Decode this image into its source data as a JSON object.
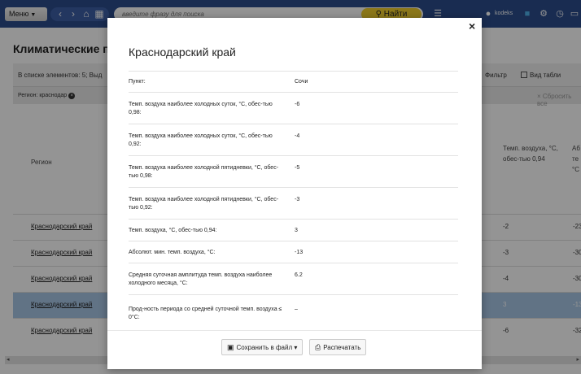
{
  "toolbar": {
    "menu_label": "Меню",
    "search_placeholder": "введите фразу для поиска",
    "search_button": "Найти",
    "user_label": "kodeks"
  },
  "page": {
    "title": "Климатические па",
    "list_info": "В списке элементов: 5; Выд",
    "filter_label": "Фильтр",
    "table_view_label": "Вид табли",
    "region_filter": "Регион: краснодар",
    "reset_all": "× Сбросить все",
    "columns": {
      "region": "Регион",
      "temp_094": "Темп. воздуха, °С, обес-тью 0,94",
      "abs": "Аб те °С"
    },
    "rows": [
      {
        "region": "Краснодарский край",
        "temp": "-2",
        "abs": "-23",
        "selected": false
      },
      {
        "region": "Краснодарский край",
        "temp": "-3",
        "abs": "-30",
        "selected": false
      },
      {
        "region": "Краснодарский край",
        "temp": "-4",
        "abs": "-30",
        "selected": false
      },
      {
        "region": "Краснодарский край",
        "temp": "3",
        "abs": "-13",
        "selected": true
      },
      {
        "region": "Краснодарский край",
        "temp": "-6",
        "abs": "-32",
        "selected": false
      }
    ]
  },
  "modal": {
    "title": "Краснодарский край",
    "close_label": "×",
    "properties": [
      {
        "label": "Пункт:",
        "value": "Сочи"
      },
      {
        "label": "Темп. воздуха наиболее холодных суток, °С, обес-тью 0,98:",
        "value": "-6"
      },
      {
        "label": "Темп. воздуха наиболее холодных суток, °С, обес-тью 0,92:",
        "value": "-4"
      },
      {
        "label": "Темп. воздуха наиболее холодной пятидневки, °С, обес-тью 0,98:",
        "value": "-5"
      },
      {
        "label": "Темп. воздуха наиболее холодной пятидневки, °С, обес-тью 0,92:",
        "value": "-3"
      },
      {
        "label": "Темп. воздуха, °С, обес-тью 0,94:",
        "value": "3"
      },
      {
        "label": "Абсолют. мин. темп. воздуха, °С:",
        "value": "-13"
      },
      {
        "label": "Средняя суточная амплитуда темп. воздуха наиболее холодного месяца, °С:",
        "value": "6.2"
      },
      {
        "label": "Прод-ность периода со средней суточной темп. воздуха ≤ 0°С:",
        "value": "–"
      }
    ],
    "save_button": "Сохранить в файл",
    "print_button": "Распечатать"
  }
}
